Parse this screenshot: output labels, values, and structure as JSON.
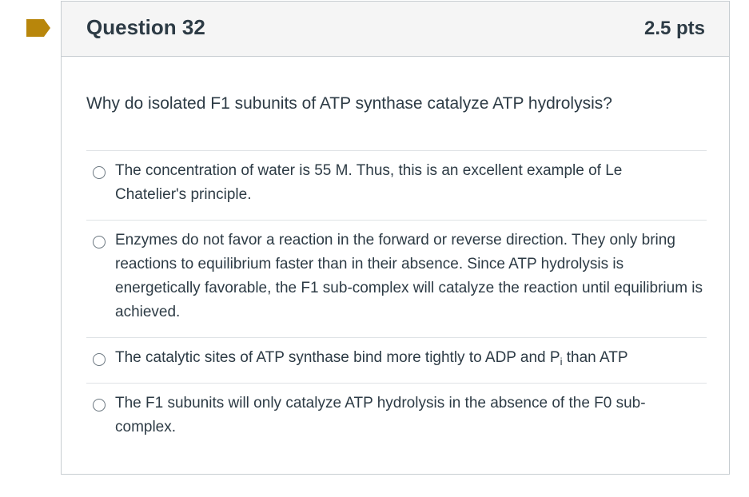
{
  "question": {
    "title": "Question 32",
    "points": "2.5 pts",
    "text": "Why do isolated F1 subunits of ATP synthase catalyze ATP hydrolysis?",
    "flag_color": "#b8860b"
  },
  "answers": [
    {
      "text": "The concentration of water is 55 M. Thus, this is an excellent example of Le Chatelier's principle."
    },
    {
      "text": "Enzymes do not favor a reaction in the forward or reverse direction. They only bring reactions to equilibrium faster than in their absence. Since ATP hydrolysis is energetically favorable, the F1 sub-complex will catalyze the reaction until equilibrium is achieved."
    },
    {
      "text_before": "The catalytic sites of ATP synthase bind more tightly to ADP and P",
      "subscript": "i",
      "text_after": " than ATP"
    },
    {
      "text": "The F1 subunits will only catalyze ATP hydrolysis in the absence of the F0 sub-complex."
    }
  ]
}
